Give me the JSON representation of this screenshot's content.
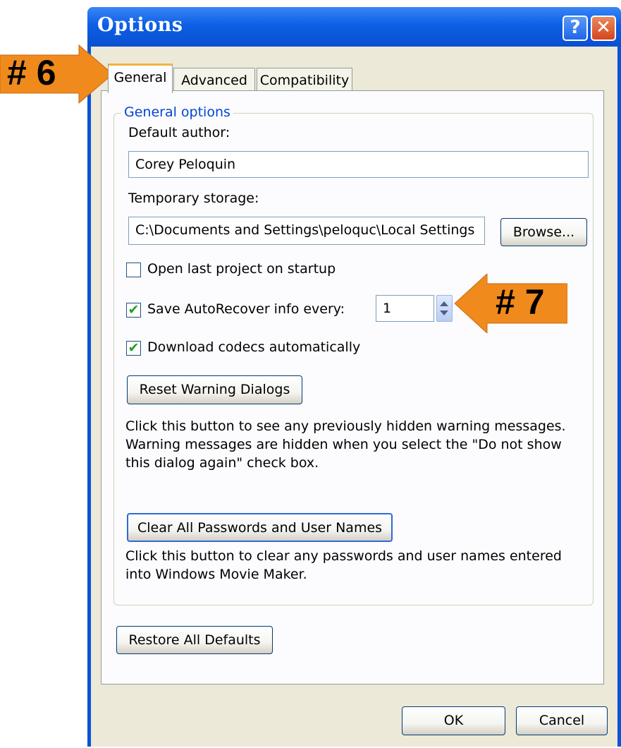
{
  "window": {
    "title": "Options",
    "help_glyph": "?",
    "close_glyph": "✕"
  },
  "tabs": [
    {
      "label": "General",
      "active": true
    },
    {
      "label": "Advanced",
      "active": false
    },
    {
      "label": "Compatibility",
      "active": false
    }
  ],
  "general": {
    "group_label": "General options",
    "default_author_label": "Default author:",
    "default_author_value": "Corey Peloquin",
    "temp_storage_label": "Temporary storage:",
    "temp_storage_value": "C:\\Documents and Settings\\peloquc\\Local Settings",
    "browse_label": "Browse...",
    "open_last_label": "Open last project on startup",
    "open_last_checked": false,
    "autorecover_label": "Save AutoRecover info every:",
    "autorecover_checked": true,
    "autorecover_value": "1",
    "download_codecs_label": "Download codecs automatically",
    "download_codecs_checked": true,
    "reset_warning_label": "Reset Warning Dialogs",
    "reset_warning_desc_1": "Click this button to see any previously hidden warning messages.",
    "reset_warning_desc_2": "Warning messages are hidden when you select the \"Do not show",
    "reset_warning_desc_3": "this dialog again\" check box.",
    "clear_passwords_label": "Clear All Passwords and User Names",
    "clear_passwords_desc_1": "Click this button to clear any passwords and user names entered",
    "clear_passwords_desc_2": "into Windows Movie Maker.",
    "restore_defaults_label": "Restore All Defaults"
  },
  "footer": {
    "ok_label": "OK",
    "cancel_label": "Cancel"
  },
  "annotations": {
    "callout_6": "# 6",
    "callout_7": "# 7",
    "callout_color": "#f08a1c"
  }
}
